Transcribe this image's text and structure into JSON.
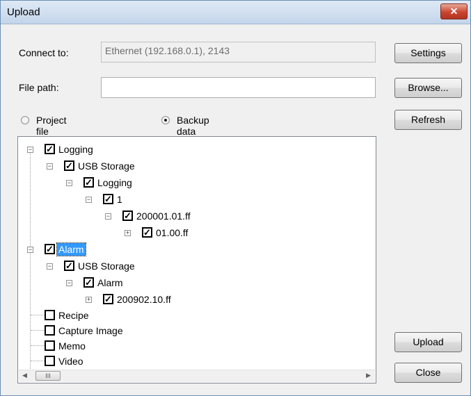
{
  "window": {
    "title": "Upload",
    "close_glyph": "✕"
  },
  "connect": {
    "label": "Connect to:",
    "value": "Ethernet (192.168.0.1), 2143"
  },
  "filepath": {
    "label": "File path:",
    "value": ""
  },
  "radios": {
    "project_label": "Project file",
    "backup_label": "Backup data",
    "selected": "Backup data"
  },
  "buttons": {
    "settings": "Settings",
    "browse": "Browse...",
    "refresh": "Refresh",
    "upload": "Upload",
    "close": "Close"
  },
  "tree": {
    "nodes": [
      {
        "label": "Logging",
        "checked": true,
        "expander": "minus"
      },
      {
        "label": "USB Storage",
        "checked": true,
        "expander": "minus"
      },
      {
        "label": "Logging",
        "checked": true,
        "expander": "minus"
      },
      {
        "label": "1",
        "checked": true,
        "expander": "minus"
      },
      {
        "label": "200001.01.ff",
        "checked": true,
        "expander": "minus"
      },
      {
        "label": "01.00.ff",
        "checked": true,
        "expander": "plus"
      },
      {
        "label": "Alarm",
        "checked": true,
        "expander": "minus",
        "selected": true
      },
      {
        "label": "USB Storage",
        "checked": true,
        "expander": "minus"
      },
      {
        "label": "Alarm",
        "checked": true,
        "expander": "minus"
      },
      {
        "label": "200902.10.ff",
        "checked": true,
        "expander": "plus"
      },
      {
        "label": "Recipe",
        "checked": false
      },
      {
        "label": "Capture Image",
        "checked": false
      },
      {
        "label": "Memo",
        "checked": false
      },
      {
        "label": "Video",
        "checked": false
      }
    ],
    "scrollbar": {
      "left_arrow": "◀",
      "right_arrow": "▶",
      "thumb_glyph": "III"
    }
  },
  "icons": {
    "check": "checkmark-icon",
    "expand": "tree-expand-icon",
    "collapse": "tree-collapse-icon"
  }
}
